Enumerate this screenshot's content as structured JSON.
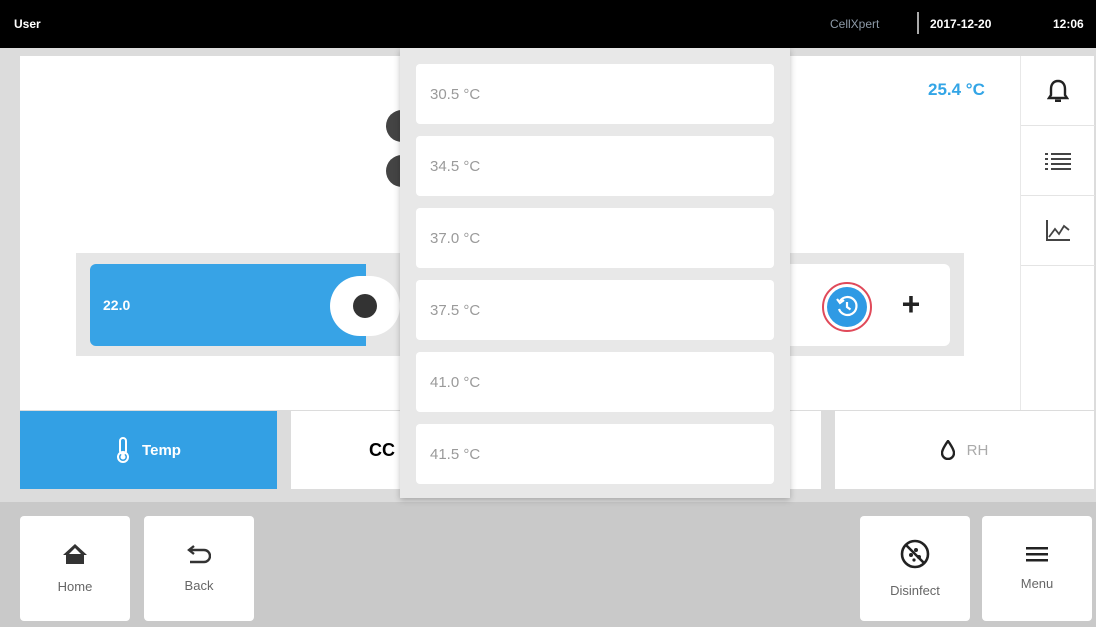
{
  "status": {
    "user": "User",
    "brand": "CellXpert",
    "date": "2017-12-20",
    "time": "12:06"
  },
  "current_temp": "25.4 °C",
  "slider": {
    "value": "22.0"
  },
  "right_icons": [
    "bell-icon",
    "list-icon",
    "chart-icon"
  ],
  "tabs": {
    "temp": "Temp",
    "co2": "CC",
    "rh": "RH"
  },
  "nav": {
    "home": "Home",
    "back": "Back",
    "disinfect": "Disinfect",
    "menu": "Menu"
  },
  "dropdown": {
    "items": [
      "30.5 °C",
      "34.5 °C",
      "37.0 °C",
      "37.5 °C",
      "41.0 °C",
      "41.5 °C"
    ]
  },
  "colors": {
    "accent": "#33a0e4",
    "highlight_ring": "#e04a5a",
    "status_bar": "#000000"
  }
}
